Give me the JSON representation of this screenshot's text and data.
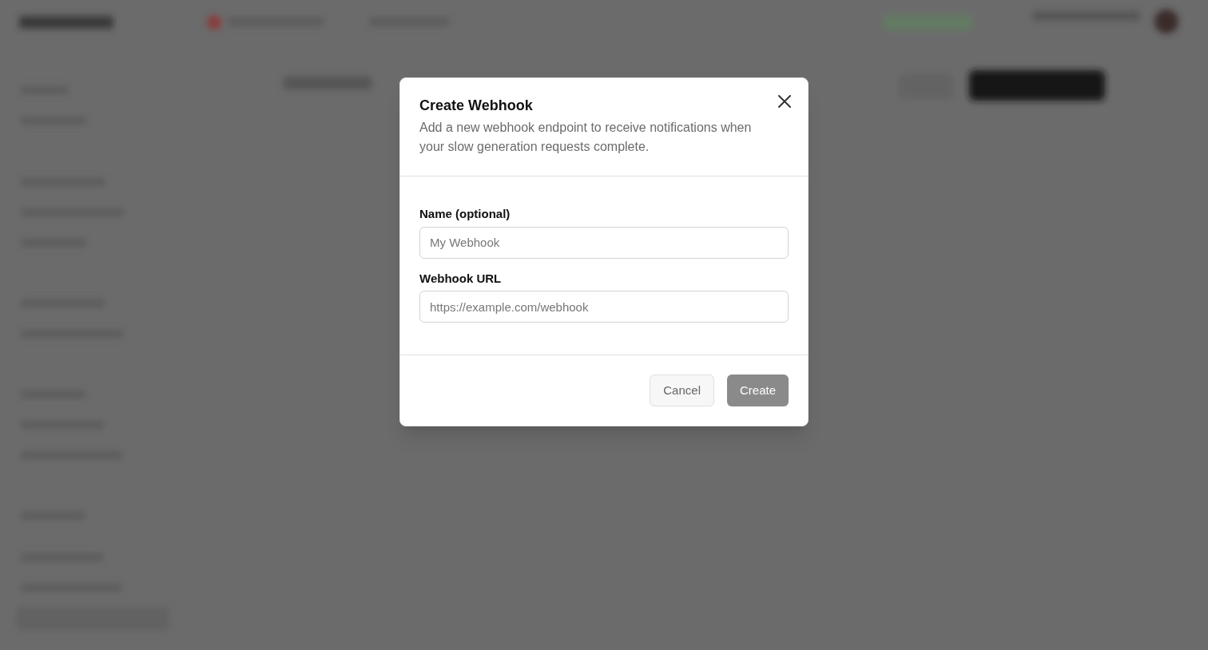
{
  "dialog": {
    "title": "Create Webhook",
    "description": "Add a new webhook endpoint to receive notifications when your slow generation requests complete.",
    "fields": [
      {
        "label": "Name (optional)",
        "placeholder": "My Webhook"
      },
      {
        "label": "Webhook URL",
        "placeholder": "https://example.com/webhook"
      }
    ],
    "buttons": [
      {
        "label": "Cancel",
        "kind": "secondary",
        "disabled": false
      },
      {
        "label": "Create",
        "kind": "primary",
        "disabled": true
      }
    ]
  }
}
